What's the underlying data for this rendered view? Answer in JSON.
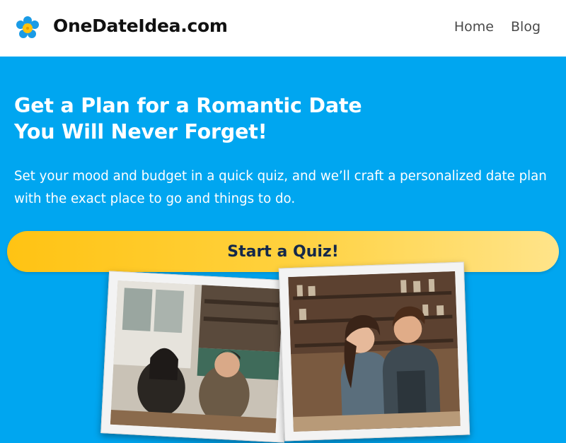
{
  "header": {
    "brand": "OneDateIdea.com",
    "logo_icon": "flower-icon",
    "nav": [
      {
        "label": "Home"
      },
      {
        "label": "Blog"
      }
    ]
  },
  "hero": {
    "title_line1": "Get a Plan for a Romantic Date",
    "title_line2": "You Will Never Forget!",
    "description": "Set your mood and budget in a quick quiz, and we’ll craft a personalized date plan with the exact place to go and things to do.",
    "cta_label": "Start a Quiz!"
  },
  "colors": {
    "hero_bg": "#00a6f0",
    "cta_yellow": "#ffc313",
    "cta_text": "#14284a",
    "logo_blue": "#1a9be6",
    "logo_yellow": "#ffc20e"
  },
  "photos": [
    {
      "icon": "couple-cafe-photo"
    },
    {
      "icon": "couple-cooking-photo"
    }
  ]
}
